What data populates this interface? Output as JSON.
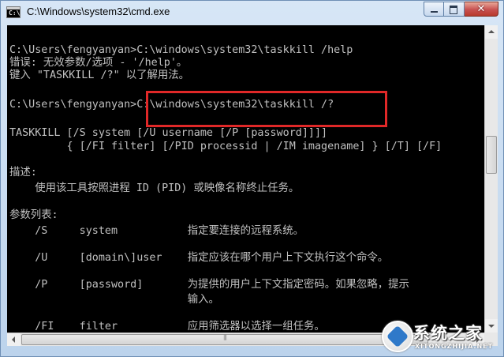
{
  "window": {
    "title": "C:\\Windows\\system32\\cmd.exe",
    "icon_text": "C:\\",
    "close_glyph": "✕"
  },
  "console": {
    "lines": [
      "C:\\Users\\fengyanyan>C:\\windows\\system32\\taskkill /help",
      "错误: 无效参数/选项 - '/help'。",
      "键入 \"TASKKILL /?\" 以了解用法。",
      "C:\\Users\\fengyanyan>C:\\windows\\system32\\taskkill /?",
      "TASKKILL [/S system [/U username [/P [password]]]]",
      "         { [/FI filter] [/PID processid | /IM imagename] } [/T] [/F]",
      "描述:",
      "    使用该工具按照进程 ID (PID) 或映像名称终止任务。",
      "参数列表:",
      "    /S     system           指定要连接的远程系统。",
      "    /U     [domain\\]user    指定应该在哪个用户上下文执行这个命令。",
      "    /P     [password]       为提供的用户上下文指定密码。如果忽略，提示",
      "                            输入。",
      "    /FI    filter           应用筛选器以选择一组任务。"
    ]
  },
  "watermark": {
    "text": "系统之家",
    "sub": "XITONGZHIJIA.NET"
  },
  "colors": {
    "console_bg": "#000000",
    "console_fg": "#c0c0c0",
    "highlight": "#e02828"
  }
}
